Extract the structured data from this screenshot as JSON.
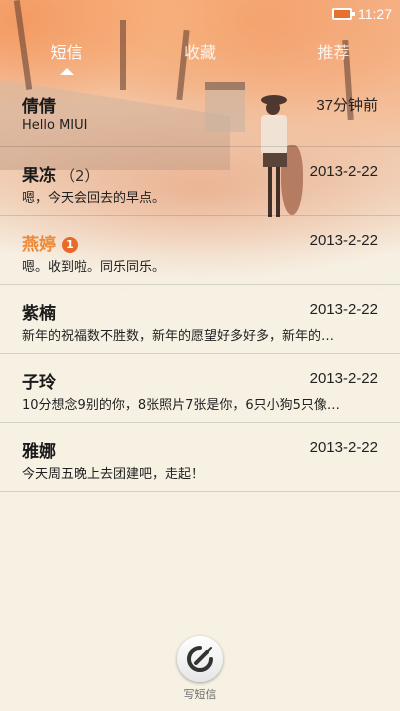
{
  "status": {
    "time": "11:27"
  },
  "tabs": [
    {
      "label": "短信",
      "active": true
    },
    {
      "label": "收藏",
      "active": false
    },
    {
      "label": "推荐",
      "active": false
    }
  ],
  "messages": [
    {
      "name": "倩倩",
      "count": "",
      "badge": "",
      "time": "37分钟前",
      "preview": "Hello MIUI",
      "unread": false
    },
    {
      "name": "果冻",
      "count": "（2）",
      "badge": "",
      "time": "2013-2-22",
      "preview": "嗯，今天会回去的早点。",
      "unread": false
    },
    {
      "name": "燕婷",
      "count": "",
      "badge": "1",
      "time": "2013-2-22",
      "preview": "嗯。收到啦。同乐同乐。",
      "unread": true
    },
    {
      "name": "紫楠",
      "count": "",
      "badge": "",
      "time": "2013-2-22",
      "preview": "新年的祝福数不胜数，新年的愿望好多好多，新年的…",
      "unread": false
    },
    {
      "name": "子玲",
      "count": "",
      "badge": "",
      "time": "2013-2-22",
      "preview": "10分想念9别的你，8张照片7张是你，6只小狗5只像…",
      "unread": false
    },
    {
      "name": "雅娜",
      "count": "",
      "badge": "",
      "time": "2013-2-22",
      "preview": "今天周五晚上去团建吧，走起！",
      "unread": false
    }
  ],
  "compose": {
    "label": "写短信",
    "icon": "compose-icon"
  },
  "colors": {
    "accent": "#ec8a3a",
    "badge": "#e8692a",
    "background": "#f6f1e3"
  }
}
